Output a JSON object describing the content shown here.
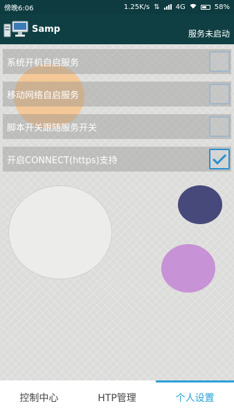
{
  "status_bar": {
    "time": "傍晚6:06",
    "net_speed": "1.25K/s",
    "network": "4G",
    "battery_text": "58%",
    "battery_level": 0.58
  },
  "app_bar": {
    "title": "Samp",
    "status": "服务未启动"
  },
  "settings": [
    {
      "label": "系统开机自启服务",
      "checked": false
    },
    {
      "label": "移动网络自启服务",
      "checked": false
    },
    {
      "label": "脚本开关跟随服务开关",
      "checked": false
    },
    {
      "label": "开启CONNECT(https)支持",
      "checked": true
    }
  ],
  "bottom_nav": {
    "tabs": [
      "控制中心",
      "HTP管理",
      "个人设置"
    ],
    "active_index": 2
  },
  "colors": {
    "primary_dark": "#0f3f43",
    "accent": "#2aa2d6",
    "checkbox_on": "#2a8fd0"
  }
}
